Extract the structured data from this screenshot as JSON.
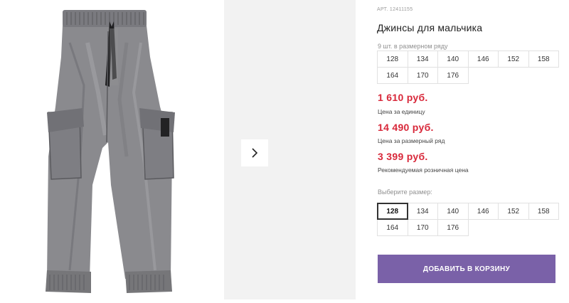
{
  "gallery": {
    "main_image": "gray-jeans-photo",
    "next_icon": "chevron-right-icon"
  },
  "product": {
    "article": "АРТ. 12411155",
    "title": "Джинсы для мальчика",
    "row_note": "9 шт. в размерном ряду",
    "sizes_row": [
      "128",
      "134",
      "140",
      "146",
      "152",
      "158",
      "164",
      "170",
      "176"
    ]
  },
  "prices": [
    {
      "amount": "1 610 руб.",
      "caption": "Цена за единицу"
    },
    {
      "amount": "14 490 руб.",
      "caption": "Цена за размерный ряд"
    },
    {
      "amount": "3 399 руб.",
      "caption": "Рекомендуемая розничная цена"
    }
  ],
  "size_picker": {
    "label": "Выберите размер:",
    "options": [
      "128",
      "134",
      "140",
      "146",
      "152",
      "158",
      "164",
      "170",
      "176"
    ],
    "selected": "128"
  },
  "cart_button": {
    "label": "ДОБАВИТЬ В КОРЗИНУ"
  },
  "colors": {
    "price": "#d8283a",
    "button": "#7a61a8"
  }
}
